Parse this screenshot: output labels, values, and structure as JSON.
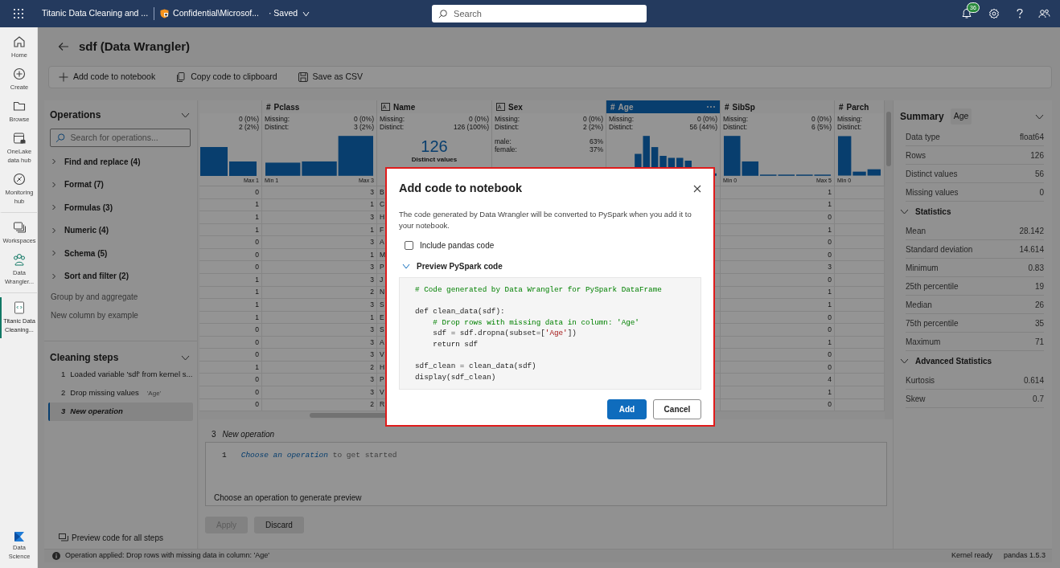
{
  "top_bar": {
    "document_title": "Titanic Data Cleaning and ...",
    "sensitivity": "Confidential\\Microsof...",
    "save_state": "· Saved",
    "search": {
      "placeholder": "Search"
    },
    "notification_count": "36"
  },
  "rail": {
    "items": [
      {
        "label": "Home",
        "kind": "home",
        "selected": false
      },
      {
        "label": "Create",
        "kind": "create",
        "selected": false
      },
      {
        "label": "Browse",
        "kind": "browse",
        "selected": false
      },
      {
        "label": "OneLake data hub",
        "kind": "datahub",
        "selected": false
      },
      {
        "label": "Monitoring hub",
        "kind": "monitor",
        "selected": false,
        "group_end": true
      },
      {
        "label": "Workspaces",
        "kind": "workspaces",
        "selected": false
      },
      {
        "label": "Data Wrangler...",
        "kind": "wrangler",
        "selected": false,
        "group_end": true
      },
      {
        "label": "Titanic Data Cleaning...",
        "kind": "notebook",
        "selected": true
      }
    ],
    "footer": {
      "label": "Data Science"
    }
  },
  "page_title": "sdf (Data Wrangler)",
  "toolbar": [
    {
      "label": "Add code to notebook",
      "kind": "add"
    },
    {
      "label": "Copy code to clipboard",
      "kind": "copy"
    },
    {
      "label": "Save as CSV",
      "kind": "save"
    }
  ],
  "operations": {
    "title": "Operations",
    "search": {
      "placeholder": "Search for operations..."
    },
    "items": [
      {
        "label": "Find and replace (4)",
        "kind": "group"
      },
      {
        "label": "Format (7)",
        "kind": "group"
      },
      {
        "label": "Formulas (3)",
        "kind": "group"
      },
      {
        "label": "Numeric (4)",
        "kind": "group"
      },
      {
        "label": "Schema (5)",
        "kind": "group"
      },
      {
        "label": "Sort and filter (2)",
        "kind": "group"
      },
      {
        "label": "Group by and aggregate",
        "kind": "action"
      },
      {
        "label": "New column by example",
        "kind": "action"
      }
    ]
  },
  "cleaning_steps": {
    "title": "Cleaning steps",
    "steps": [
      {
        "number": "1",
        "label": "Loaded variable 'sdf' from kernel s...",
        "selected": false
      },
      {
        "number": "2",
        "label": "Drop missing values",
        "tag": "'Age'",
        "selected": false
      },
      {
        "number": "3",
        "label": "New operation",
        "selected": true
      }
    ],
    "preview_link": "Preview code for all steps"
  },
  "grid": {
    "columns": [
      {
        "selected": false,
        "missing": "0 (0%)",
        "distinct": "2 (2%)",
        "summary": {
          "kind": "histogram",
          "max": "Max 1"
        }
      },
      {
        "type_mark": "#",
        "name": "Pclass",
        "selected": false,
        "missing_label": "Missing:",
        "missing": "0 (0%)",
        "distinct_label": "Distinct:",
        "distinct": "3 (2%)",
        "summary": {
          "kind": "histogram",
          "min": "Min 1",
          "max": "Max 3"
        }
      },
      {
        "kind": "text",
        "name": "Name",
        "selected": false,
        "missing_label": "Missing:",
        "missing": "0 (0%)",
        "distinct_label": "Distinct:",
        "distinct": "126 (100%)",
        "summary": {
          "kind": "distinct",
          "count": "126",
          "caption": "Distinct values"
        }
      },
      {
        "kind": "text",
        "name": "Sex",
        "selected": false,
        "missing_label": "Missing:",
        "missing": "0 (0%)",
        "distinct_label": "Distinct:",
        "distinct": "2 (2%)",
        "summary": {
          "kind": "categories",
          "items": [
            {
              "label": "male:",
              "value": "63%"
            },
            {
              "label": "female:",
              "value": "37%"
            }
          ]
        }
      },
      {
        "type_mark": "#",
        "name": "Age",
        "selected": true,
        "missing_label": "Missing:",
        "missing": "0 (0%)",
        "distinct_label": "Distinct:",
        "distinct": "56 (44%)",
        "summary": {
          "kind": "histogram"
        }
      },
      {
        "type_mark": "#",
        "name": "SibSp",
        "selected": false,
        "missing_label": "Missing:",
        "missing": "0 (0%)",
        "distinct_label": "Distinct:",
        "distinct": "6 (5%)",
        "summary": {
          "kind": "histogram",
          "min": "Min 0",
          "max": "Max 5"
        }
      },
      {
        "type_mark": "#",
        "name": "Parch",
        "selected": false,
        "missing_label": "Missing:",
        "distinct_label": "Distinct:",
        "summary": {
          "kind": "histogram",
          "min": "Min 0"
        }
      }
    ],
    "rows": [
      {
        "column_1": "0",
        "pclass": "3",
        "name": "B",
        "sibsp": "1"
      },
      {
        "column_1": "1",
        "pclass": "1",
        "name": "C",
        "sibsp": "1"
      },
      {
        "column_1": "1",
        "pclass": "3",
        "name": "H",
        "sibsp": "0"
      },
      {
        "column_1": "1",
        "pclass": "1",
        "name": "F",
        "sibsp": "1"
      },
      {
        "column_1": "0",
        "pclass": "3",
        "name": "A",
        "sibsp": "0"
      },
      {
        "column_1": "0",
        "pclass": "1",
        "name": "M",
        "sibsp": "0"
      },
      {
        "column_1": "0",
        "pclass": "3",
        "name": "P",
        "sibsp": "3"
      },
      {
        "column_1": "1",
        "pclass": "3",
        "name": "J",
        "sibsp": "0"
      },
      {
        "column_1": "1",
        "pclass": "2",
        "name": "N",
        "sibsp": "1"
      },
      {
        "column_1": "1",
        "pclass": "3",
        "name": "S",
        "sibsp": "1"
      },
      {
        "column_1": "1",
        "pclass": "1",
        "name": "E",
        "sibsp": "0"
      },
      {
        "column_1": "0",
        "pclass": "3",
        "name": "S",
        "sibsp": "0"
      },
      {
        "column_1": "0",
        "pclass": "3",
        "name": "A",
        "sibsp": "1"
      },
      {
        "column_1": "0",
        "pclass": "3",
        "name": "V",
        "sibsp": "0"
      },
      {
        "column_1": "1",
        "pclass": "2",
        "name": "H",
        "sibsp": "0"
      },
      {
        "column_1": "0",
        "pclass": "3",
        "name": "P",
        "sibsp": "4"
      },
      {
        "column_1": "0",
        "pclass": "3",
        "name": "V",
        "sibsp": "1"
      },
      {
        "column_1": "0",
        "pclass": "2",
        "name": "R",
        "sibsp": "0"
      }
    ]
  },
  "editor": {
    "step_number": "3",
    "step_title": "New operation",
    "line_number": "1",
    "hint_link": "Choose an operation",
    "hint_rest": "to get started",
    "preview_message": "Choose an operation to generate preview",
    "buttons": [
      {
        "label": "Apply",
        "disabled": true
      },
      {
        "label": "Discard",
        "disabled": false
      }
    ]
  },
  "summary": {
    "title": "Summary",
    "column_tag": "Age",
    "rows": [
      {
        "label": "Data type",
        "value": "float64"
      },
      {
        "label": "Rows",
        "value": "126"
      },
      {
        "label": "Distinct values",
        "value": "56"
      },
      {
        "label": "Missing values",
        "value": "0"
      }
    ],
    "sections": [
      {
        "title": "Statistics",
        "expanded": true,
        "rows": [
          {
            "label": "Mean",
            "value": "28.142"
          },
          {
            "label": "Standard deviation",
            "value": "14.614"
          },
          {
            "label": "Minimum",
            "value": "0.83"
          },
          {
            "label": "25th percentile",
            "value": "19"
          },
          {
            "label": "Median",
            "value": "26"
          },
          {
            "label": "75th percentile",
            "value": "35"
          },
          {
            "label": "Maximum",
            "value": "71"
          }
        ]
      },
      {
        "title": "Advanced Statistics",
        "expanded": true,
        "rows": [
          {
            "label": "Kurtosis",
            "value": "0.614"
          },
          {
            "label": "Skew",
            "value": "0.7"
          }
        ]
      }
    ]
  },
  "status_bar": {
    "message": "Operation applied: Drop rows with missing data in column: 'Age'",
    "kernel": "Kernel ready",
    "version": "pandas 1.5.3"
  },
  "dialog": {
    "title": "Add code to notebook",
    "description": "The code generated by Data Wrangler will be converted to PySpark when you add it to your notebook.",
    "checkbox": {
      "label": "Include pandas code",
      "checked": false
    },
    "preview": {
      "label": "Preview PySpark code",
      "expanded": true,
      "lines": [
        {
          "kind": "code",
          "tokens": [
            {
              "text": "# Code generated by Data Wrangler for PySpark DataFrame",
              "kind": "comment"
            }
          ]
        },
        {
          "kind": "blank"
        },
        {
          "kind": "code",
          "tokens": [
            {
              "text": "def clean_data(sdf):",
              "kind": "plain"
            }
          ]
        },
        {
          "kind": "code",
          "tokens": [
            {
              "text": "    # Drop rows with missing data in column: 'Age'",
              "kind": "comment"
            }
          ]
        },
        {
          "kind": "code",
          "tokens": [
            {
              "text": "    sdf = sdf.dropna(subset=[",
              "kind": "plain"
            },
            {
              "text": "'Age'",
              "kind": "string"
            },
            {
              "text": "])",
              "kind": "plain"
            }
          ]
        },
        {
          "kind": "code",
          "tokens": [
            {
              "text": "    return sdf",
              "kind": "plain"
            }
          ]
        },
        {
          "kind": "blank"
        },
        {
          "kind": "code",
          "tokens": [
            {
              "text": "sdf_clean = clean_data(sdf)",
              "kind": "plain"
            }
          ]
        },
        {
          "kind": "code",
          "tokens": [
            {
              "text": "display(sdf_clean)",
              "kind": "plain"
            }
          ]
        }
      ]
    },
    "buttons": [
      {
        "label": "Add",
        "kind": "primary"
      },
      {
        "label": "Cancel",
        "kind": "secondary"
      }
    ]
  }
}
